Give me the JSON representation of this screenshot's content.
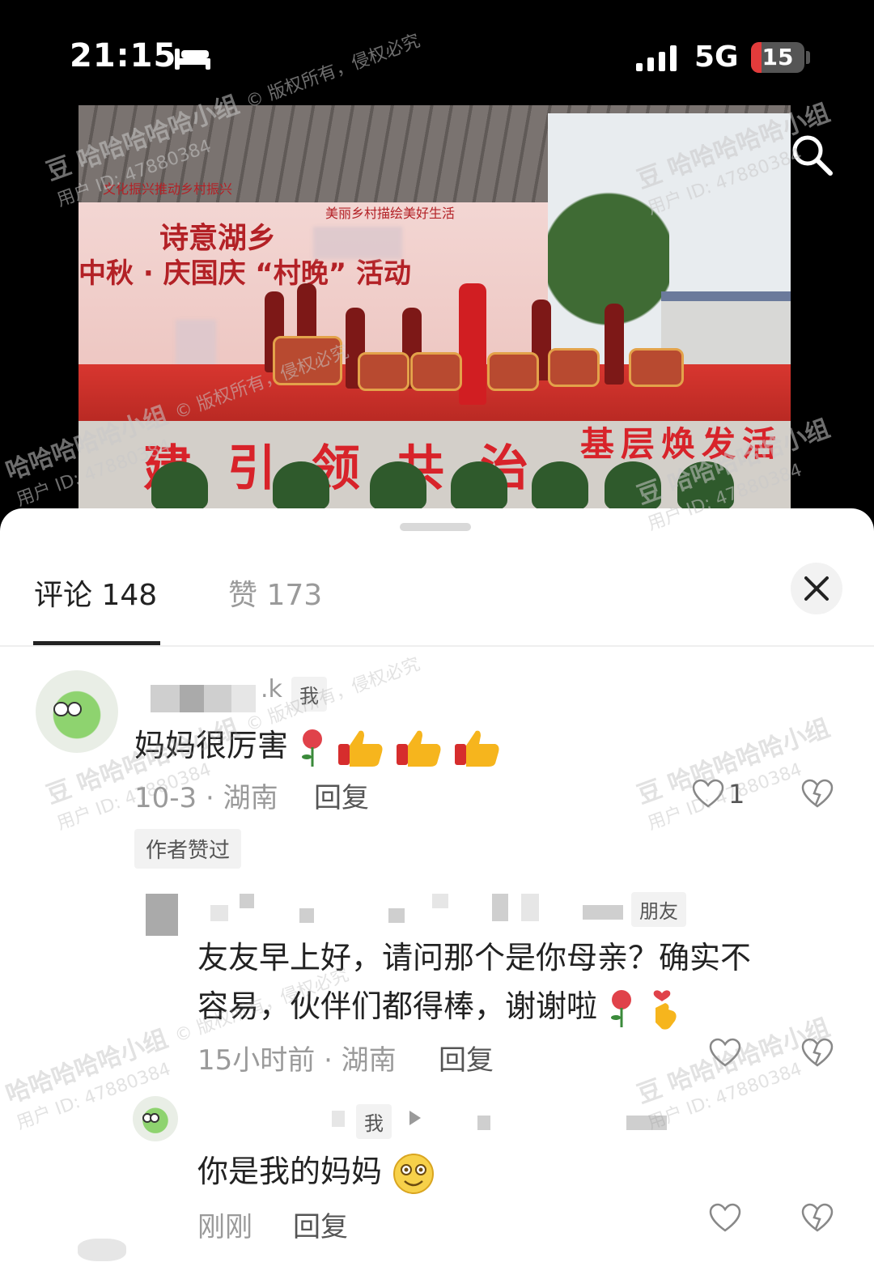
{
  "status_bar": {
    "time": "21:15",
    "network": "5G",
    "battery": "15"
  },
  "video": {
    "poster_title": "诗意湖乡",
    "poster_subtitle": "中秋 · 庆国庆 “村晚” 活动",
    "poster_line1": "文化振兴推动乡村振兴",
    "poster_line2": "美丽乡村描绘美好生活",
    "stage_slogan": "建引领共治",
    "stage_slogan_right": "基层焕发活",
    "watermark_group": "哈哈哈哈哈小组",
    "watermark_copyright": "© 版权所有，侵权必究",
    "watermark_user": "用户 ID: 47880384",
    "watermark_badge": "豆"
  },
  "sheet": {
    "tabs": [
      {
        "label": "评论 148",
        "active": true
      },
      {
        "label": "赞 173",
        "active": false
      }
    ]
  },
  "comments": [
    {
      "name_tail": ".k",
      "tag": "我",
      "text": "妈妈很厉害",
      "time_location": "10-3 · 湖南",
      "reply": "回复",
      "likes": "1",
      "author_liked": "作者赞过"
    },
    {
      "tag": "朋友",
      "text_line1": "友友早上好，请问那个是你母亲？确实不",
      "text_line2": "容易，伙伴们都得棒，谢谢啦",
      "time_location": "15小时前 · 湖南",
      "reply": "回复"
    },
    {
      "tag": "我",
      "text": "你是我的妈妈",
      "time_location": "刚刚",
      "reply": "回复"
    }
  ],
  "colors": {
    "accent_red": "#d8232a",
    "text_dark": "#222222",
    "text_gray": "#9a9a9a"
  }
}
